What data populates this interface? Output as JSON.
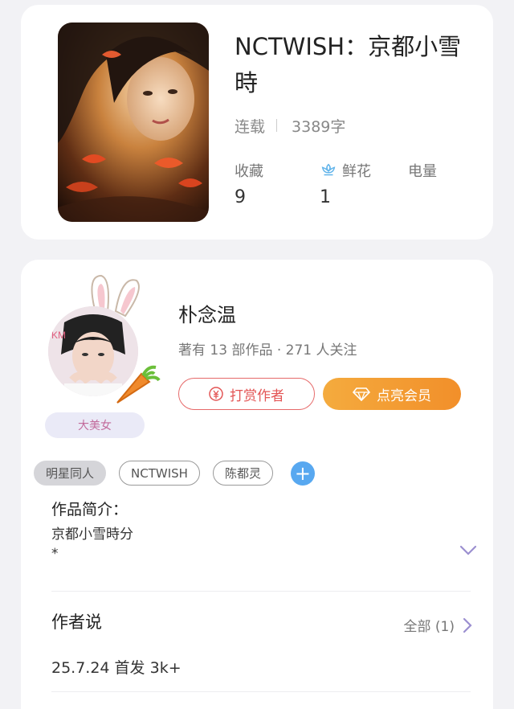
{
  "book": {
    "title": "NCTWISH：京都小雪時",
    "status": "连载",
    "word_count": "3389字",
    "stats": {
      "collect_label": "收藏",
      "collect_value": "9",
      "flower_label": "鲜花",
      "flower_value": "1",
      "power_label": "电量",
      "power_value": ""
    }
  },
  "author": {
    "name": "朴念温",
    "stats": "著有 13 部作品 · 271 人关注",
    "badge": "大美女",
    "tip_label": "打赏作者",
    "vip_label": "点亮会员"
  },
  "tags": [
    "明星同人",
    "NCTWISH",
    "陈都灵"
  ],
  "intro": {
    "title": "作品简介：",
    "line1": "京都小雪時分",
    "line2": "*"
  },
  "author_say": {
    "title": "作者说",
    "all_label": "全部 (1)",
    "latest": "25.7.24 首发 3k+"
  },
  "colors": {
    "accent_red": "#e35555",
    "accent_orange": "#f28f2a",
    "tag_add_blue": "#58a8f0",
    "chevron_purple": "#9b8fd0"
  },
  "icons": {
    "flower": "flower-icon",
    "coin": "coin-icon",
    "diamond": "diamond-icon",
    "chevron_down": "chevron-down-icon",
    "chevron_right": "chevron-right-icon",
    "plus": "plus-icon"
  }
}
